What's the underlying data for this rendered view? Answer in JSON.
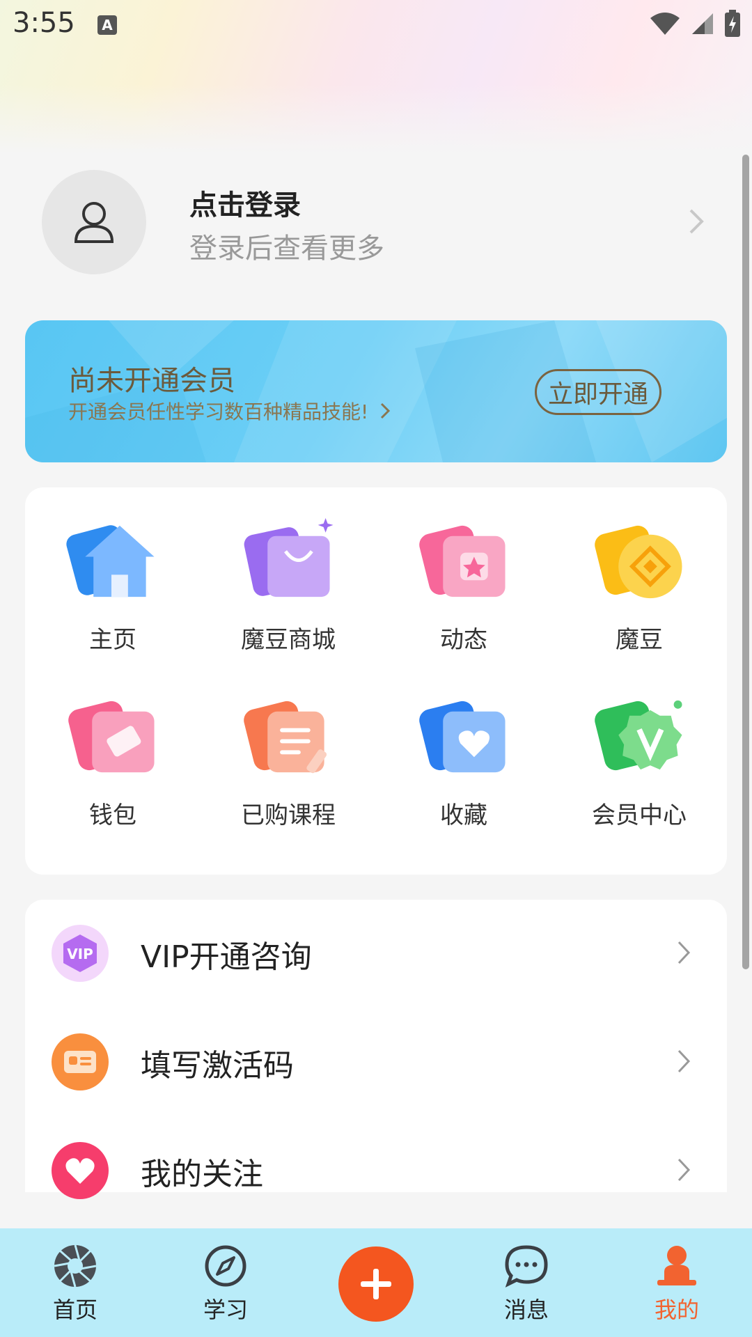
{
  "status_bar": {
    "time": "3:55",
    "notification_icon_letter": "A"
  },
  "profile": {
    "title": "点击登录",
    "subtitle": "登录后查看更多"
  },
  "member_banner": {
    "title": "尚未开通会员",
    "subtitle": "开通会员任性学习数百种精品技能!",
    "button_label": "立即开通"
  },
  "grid": {
    "items": [
      {
        "label": "主页",
        "icon": "home-icon"
      },
      {
        "label": "魔豆商城",
        "icon": "shopping-bag-icon"
      },
      {
        "label": "动态",
        "icon": "star-card-icon"
      },
      {
        "label": "魔豆",
        "icon": "coin-icon"
      },
      {
        "label": "钱包",
        "icon": "ticket-icon"
      },
      {
        "label": "已购课程",
        "icon": "document-icon"
      },
      {
        "label": "收藏",
        "icon": "heart-card-icon"
      },
      {
        "label": "会员中心",
        "icon": "vip-badge-icon"
      }
    ]
  },
  "list": {
    "items": [
      {
        "label": "VIP开通咨询",
        "icon": "vip-icon",
        "icon_text": "VIP"
      },
      {
        "label": "填写激活码",
        "icon": "id-card-icon"
      },
      {
        "label": "我的关注",
        "icon": "heart-icon"
      }
    ]
  },
  "bottom_nav": {
    "items": [
      {
        "label": "首页",
        "icon": "aperture-icon"
      },
      {
        "label": "学习",
        "icon": "compass-icon"
      },
      {
        "label": "消息",
        "icon": "chat-bubble-icon"
      },
      {
        "label": "我的",
        "icon": "person-icon",
        "active": true
      }
    ],
    "fab_icon": "plus-icon"
  },
  "colors": {
    "accent": "#f4561f",
    "active_tab": "#f26330",
    "banner": "#6ccff6",
    "nav_bg": "#b9ecf9"
  }
}
